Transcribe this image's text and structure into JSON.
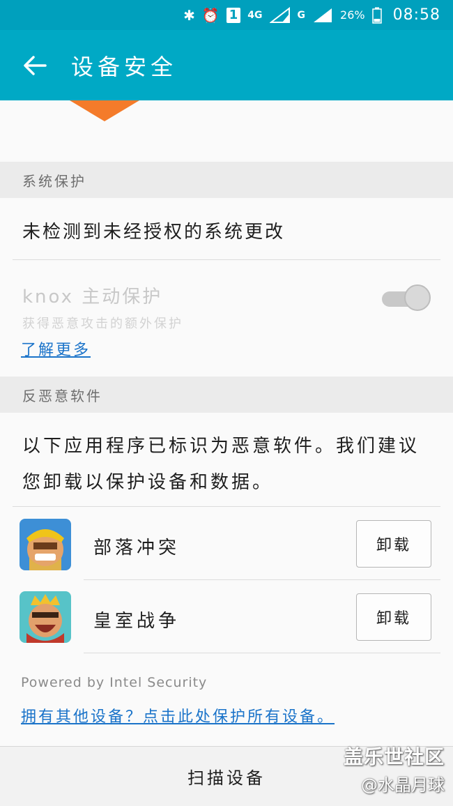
{
  "status_bar": {
    "signal_4g": "4G",
    "signal_g": "G",
    "sim_number": "1",
    "battery": "26%",
    "time": "08:58"
  },
  "app_bar": {
    "title": "设备安全"
  },
  "system_protection": {
    "header": "系统保护",
    "status_text": "未检测到未经授权的系统更改",
    "knox_title": "knox 主动保护",
    "knox_subtitle": "获得恶意攻击的额外保护",
    "learn_more": "了解更多",
    "knox_enabled": true
  },
  "anti_malware": {
    "header": "反恶意软件",
    "warning": "以下应用程序已标识为恶意软件。我们建议您卸载以保护设备和数据。",
    "apps": [
      {
        "name": "部落冲突",
        "action": "卸载",
        "icon": "clash-of-clans-icon"
      },
      {
        "name": "皇室战争",
        "action": "卸载",
        "icon": "clash-royale-icon"
      }
    ],
    "powered_by": "Powered by Intel Security",
    "protect_link": "拥有其他设备？点击此处保护所有设备。"
  },
  "bottom": {
    "scan_label": "扫描设备"
  },
  "watermark": {
    "line1": "盖乐世社区",
    "line2": "@水晶月球"
  },
  "colors": {
    "app_bar": "#00a9c5",
    "link": "#1a73c9",
    "shield": "#f47b2a"
  }
}
